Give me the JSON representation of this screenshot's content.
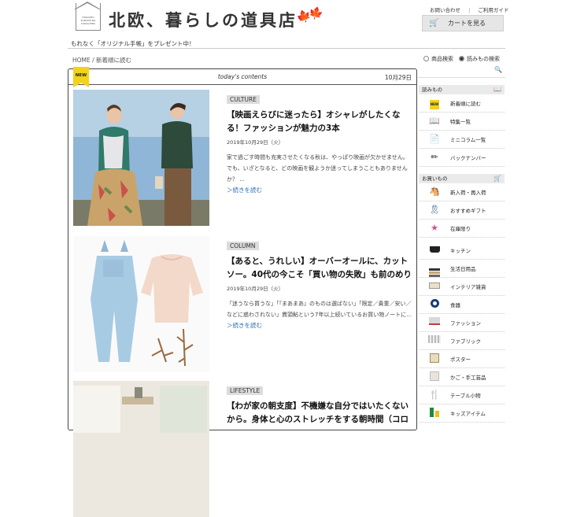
{
  "header": {
    "logo_text": "HOKUSHO\nKURASHI NO\nDOUGUTEN",
    "site_title": "北欧、暮らしの道具店",
    "registered_mark": "®",
    "leaf_icons": [
      "🍁",
      "🍁"
    ],
    "util_links": [
      "お問い合わせ",
      "ご利用ガイド"
    ],
    "cart_label": "カートを見る",
    "promo": "もれなく「オリジナル手帳」をプレゼント中！"
  },
  "breadcrumb": "HOME / 新着順に読む",
  "search_options": [
    {
      "label": "商品検索",
      "selected": false
    },
    {
      "label": "読みもの検索",
      "selected": true
    }
  ],
  "main": {
    "new_badge": "NEW",
    "heading": "today's contents",
    "date": "10月29日",
    "articles": [
      {
        "tag": "CULTURE",
        "title": "【映画えらびに迷ったら】オシャレがしたくなる！ファッションが魅力の3本",
        "date": "2019年10月29日（火）",
        "text": "家で過ごす時間も充実させたくなる秋は、やっぱり映画が欠かせません。でも、いざとなると、どの映画を観ようか迷ってしまうこともありませんか？ ...",
        "more": "＞続きを読む"
      },
      {
        "tag": "COLUMN",
        "title": "【あると、うれしい】オーバーオールに、カットソー。40代の今こそ「買い物の失敗」も前のめり",
        "date": "2019年10月29日（火）",
        "text": "「迷うなら買うな」「『まあまあ』のものは選ばない」「限定／貴重／安い／などに惑わされない」貫頭鮎という7年以上続いているお買い物ノートに...",
        "more": "＞続きを読む"
      },
      {
        "tag": "LIFESTYLE",
        "title": "【わが家の朝支度】不機嫌な自分ではいたくないから。身体と心のストレッチをする朝時間（コロ",
        "date": "",
        "text": "",
        "more": ""
      }
    ]
  },
  "sidebar": {
    "reading_header": "読みもの",
    "reading_items": [
      {
        "label": "新着順に読む",
        "icon": "new-badge-icon"
      },
      {
        "label": "特集一覧",
        "icon": "book-icon"
      },
      {
        "label": "ミニコラム一覧",
        "icon": "papers-icon"
      },
      {
        "label": "バックナンバー",
        "icon": "pencil-icon"
      }
    ],
    "shop_header": "お買いもの",
    "shop_items": [
      {
        "label": "新入荷・再入荷",
        "icon": "horse-icon"
      },
      {
        "label": "おすすめギフト",
        "icon": "ribbon-icon"
      },
      {
        "label": "在庫限り",
        "icon": "star-icon"
      },
      {
        "label": "キッチン",
        "icon": "pot-icon"
      },
      {
        "label": "生活日用品",
        "icon": "towels-icon"
      },
      {
        "label": "インテリア雑貨",
        "icon": "lamp-icon"
      },
      {
        "label": "食器",
        "icon": "cup-icon"
      },
      {
        "label": "ファッション",
        "icon": "bag-icon"
      },
      {
        "label": "ファブリック",
        "icon": "fabric-icon"
      },
      {
        "label": "ポスター",
        "icon": "poster-icon"
      },
      {
        "label": "かご・手工芸品",
        "icon": "basket-icon"
      },
      {
        "label": "テーブル小物",
        "icon": "cutlery-icon"
      },
      {
        "label": "キッズアイテム",
        "icon": "kids-icon"
      }
    ]
  }
}
